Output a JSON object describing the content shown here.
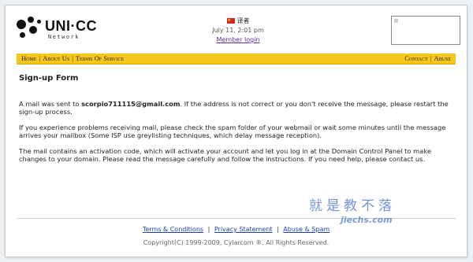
{
  "header": {
    "logo_text": "UNI·CC",
    "logo_sub": "Network",
    "language": "译者",
    "date": "July 11, 2:01 pm",
    "member_login": "Member login"
  },
  "nav": {
    "left": [
      "Home",
      "About Us",
      "Terms Of Service"
    ],
    "right": [
      "Contact",
      "Abuse"
    ]
  },
  "main": {
    "title": "Sign-up Form",
    "p1_prefix": "A mail was sent to ",
    "email": "scorpio711115@gmail.com",
    "p1_suffix": ". If the address is not correct or you don't receive the message, please restart the sign-up process.",
    "p2": "If you experience problems receiving mail, please check the spam folder of your webmail or wait some minutes until the message arrives your mailbox (Some ISP use greylisting techniques, which delay message reception).",
    "p3": "The mail contains an activation code, which will activate your account and let you log in at the Domain Control Panel to make changes to your domain. Please read the message carefully and follow the instructions. If you need help, please contact us."
  },
  "footer": {
    "links": [
      "Terms & Conditions",
      "Privacy Statement",
      "Abuse & Spam"
    ],
    "copyright": "Copyright(C) 1999-2009, Cylarcom ®. All Rights Reserved."
  },
  "watermark": {
    "text": "就是教不落",
    "url": "jiechs.com"
  },
  "colors": {
    "nav_bar": "#f6c61b",
    "link": "#1f3fa6",
    "member_link": "#5c2ca3",
    "watermark": "#5b7fd6"
  }
}
